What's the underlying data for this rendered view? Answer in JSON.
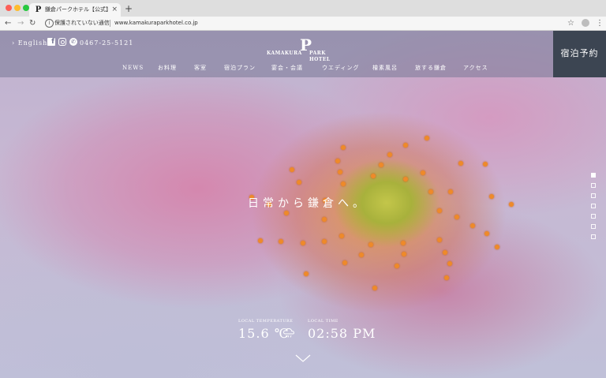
{
  "browser": {
    "tab_title": "鎌倉パークホテル【公式】 | KAMAKURA PARK HOTEL",
    "tab_favicon": "P",
    "tab_close": "×",
    "new_tab": "+",
    "security_text": "保護されていない通信",
    "url": "www.kamakuraparkhotel.co.jp",
    "icons": [
      "back-icon",
      "forward-icon",
      "reload-icon",
      "info-icon",
      "star-icon",
      "profile-icon",
      "menu-icon"
    ]
  },
  "header": {
    "language_link": "English",
    "phone": "0467-25-5121",
    "logo_mark": "P",
    "logo_left": "KAMAKURA",
    "logo_right": "PARK HOTEL",
    "reserve_label": "宿泊予約",
    "nav": [
      {
        "label": "NEWS"
      },
      {
        "label": "お料理"
      },
      {
        "label": "客室"
      },
      {
        "label": "宿泊プラン"
      },
      {
        "label": "宴会・会議"
      },
      {
        "label": "ウエディング"
      },
      {
        "label": "檜素風呂"
      },
      {
        "label": "旅する鎌倉"
      },
      {
        "label": "アクセス"
      }
    ]
  },
  "hero": {
    "copy": "日常から鎌倉へ。",
    "slides_total": 7,
    "active_slide": 1
  },
  "weather": {
    "temperature_label": "LOCAL TEMPERATURE",
    "temperature_value": "15.6 ℃",
    "weather_icon": "cloud-rain-icon",
    "time_label": "LOCAL TIME",
    "time_value": "02:58 PM"
  },
  "colors": {
    "header_overlay": "#787896",
    "reserve_bg": "#3c4552",
    "accent_orange": "#ee8a2a"
  }
}
